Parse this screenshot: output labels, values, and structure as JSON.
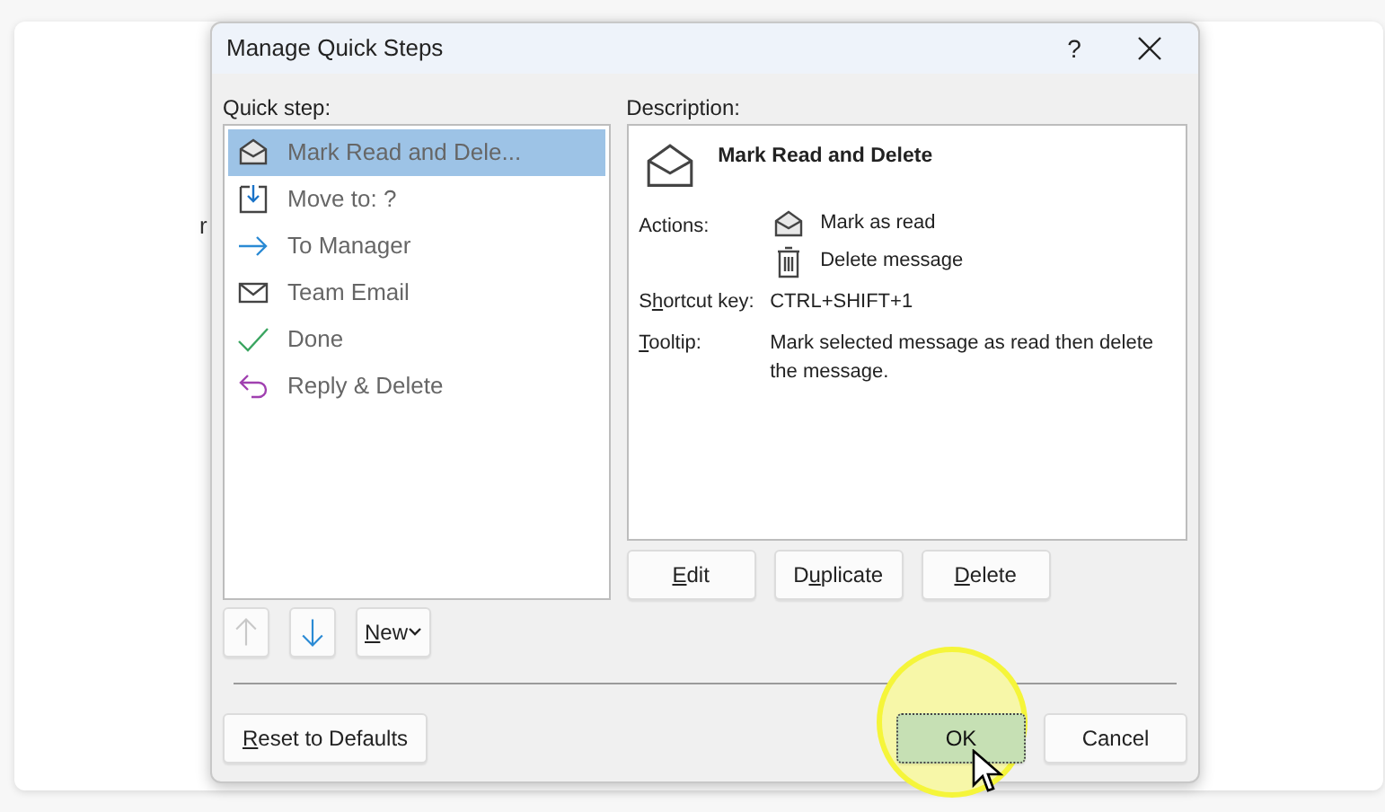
{
  "background_fragment": "r",
  "dialog": {
    "title": "Manage Quick Steps",
    "help": "?"
  },
  "quick_steps": {
    "label": "Quick step:",
    "items": [
      {
        "label": "Mark Read and Dele...",
        "kind": "read",
        "selected": true
      },
      {
        "label": "Move to: ?",
        "kind": "move",
        "selected": false
      },
      {
        "label": "To Manager",
        "kind": "forward",
        "selected": false
      },
      {
        "label": "Team Email",
        "kind": "mail",
        "selected": false
      },
      {
        "label": "Done",
        "kind": "done",
        "selected": false
      },
      {
        "label": "Reply & Delete",
        "kind": "reply",
        "selected": false
      }
    ]
  },
  "description": {
    "label": "Description:",
    "name": "Mark Read and Delete",
    "actions_label": "Actions:",
    "actions": [
      {
        "kind": "read",
        "label": "Mark as read"
      },
      {
        "kind": "delete",
        "label": "Delete message"
      }
    ],
    "shortcut_label": {
      "before": "S",
      "key": "h",
      "after": "ortcut key:"
    },
    "shortcut": "CTRL+SHIFT+1",
    "tooltip_label": {
      "key": "T",
      "after": "ooltip:"
    },
    "tooltip": "Mark selected message as read then delete the message."
  },
  "edit_buttons": [
    {
      "key": "E",
      "after": "dit"
    },
    {
      "before": "D",
      "key": "u",
      "after": "plicate"
    },
    {
      "key": "D",
      "after": "elete"
    }
  ],
  "move_buttons": [
    {
      "kind": "up",
      "disabled": true
    },
    {
      "kind": "down",
      "disabled": false
    }
  ],
  "new_button": {
    "key": "N",
    "after": "ew"
  },
  "reset_button": {
    "key": "R",
    "after": "eset to Defaults"
  },
  "ok_button": {
    "label": "OK",
    "focused": true
  },
  "cancel_button": {
    "label": "Cancel",
    "focused": false
  }
}
